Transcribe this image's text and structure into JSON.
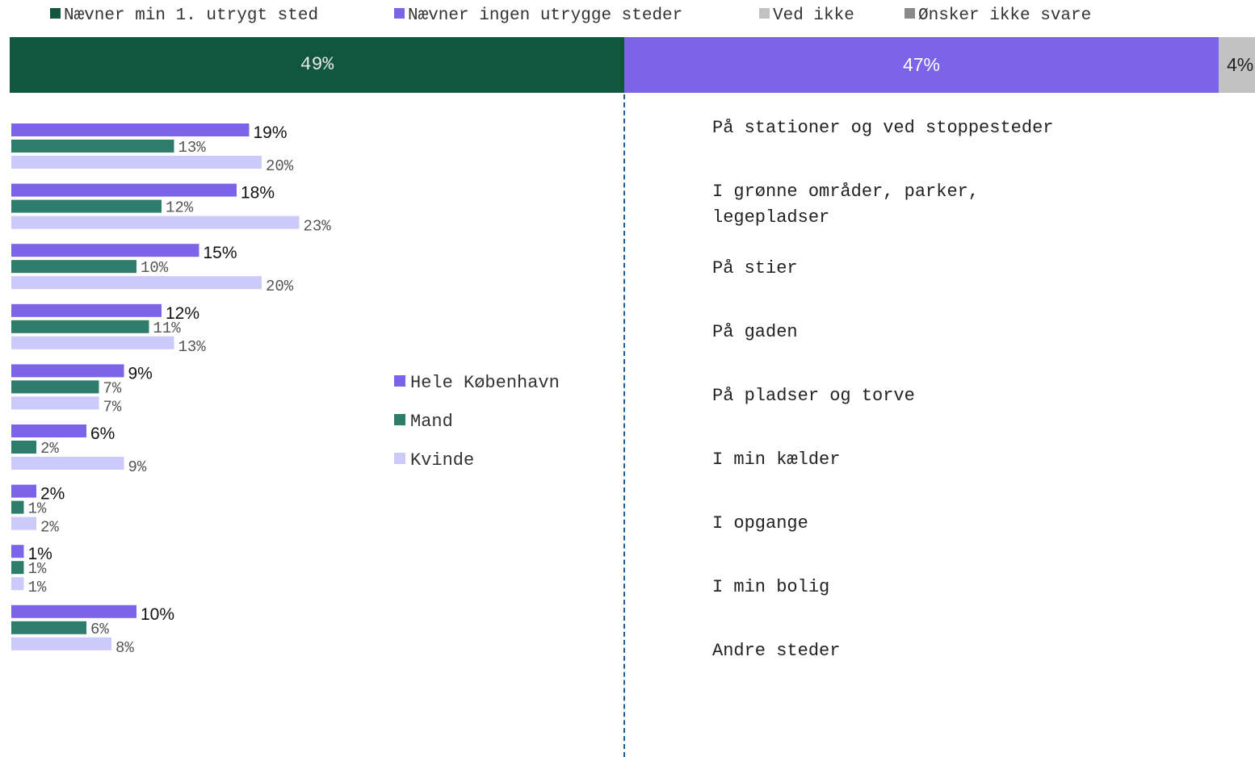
{
  "colors": {
    "dark_green": "#115740",
    "purple": "#7b64e8",
    "light_grey": "#c2c2c2",
    "mid_grey": "#8a8a8a",
    "teal": "#2e7d6a",
    "lavender": "#ccc9fb"
  },
  "top_legend": [
    {
      "label": "Nævner min 1. utrygt sted",
      "color": "#115740"
    },
    {
      "label": "Nævner ingen utrygge steder",
      "color": "#7b64e8"
    },
    {
      "label": "Ved ikke",
      "color": "#c2c2c2"
    },
    {
      "label": "Ønsker ikke svare",
      "color": "#8a8a8a"
    }
  ],
  "stack": [
    {
      "value": 49,
      "label": "49%",
      "color": "#115740"
    },
    {
      "value": 47,
      "label": "47%",
      "color": "#7b64e8"
    },
    {
      "value": 4,
      "label": "4%",
      "color": "#c2c2c2"
    }
  ],
  "legend2": [
    {
      "label": "Hele København",
      "color": "#7b64e8"
    },
    {
      "label": "Mand",
      "color": "#2e7d6a"
    },
    {
      "label": "Kvinde",
      "color": "#ccc9fb"
    }
  ],
  "chart_data": {
    "type": "bar",
    "orientation": "horizontal",
    "categories": [
      "På stationer og ved stoppesteder",
      "I grønne områder, parker, legepladser",
      "På stier",
      "På gaden",
      "På pladser og torve",
      "I min kælder",
      "I opgange",
      "I min bolig",
      "Andre steder"
    ],
    "series": [
      {
        "name": "Hele København",
        "values": [
          19,
          18,
          15,
          12,
          9,
          6,
          2,
          1,
          10
        ],
        "labels": [
          "19%",
          "18%",
          "15%",
          "12%",
          "9%",
          "6%",
          "2%",
          "1%",
          "10%"
        ]
      },
      {
        "name": "Mand",
        "values": [
          13,
          12,
          10,
          11,
          7,
          2,
          1,
          1,
          6
        ],
        "labels": [
          "13%",
          "12%",
          "10%",
          "11%",
          "7%",
          "2%",
          "1%",
          "1%",
          "6%"
        ]
      },
      {
        "name": "Kvinde",
        "values": [
          20,
          23,
          20,
          13,
          7,
          9,
          2,
          1,
          8
        ],
        "labels": [
          "20%",
          "23%",
          "20%",
          "13%",
          "7%",
          "9%",
          "2%",
          "1%",
          "8%"
        ]
      }
    ],
    "xlim": [
      0,
      25
    ]
  }
}
